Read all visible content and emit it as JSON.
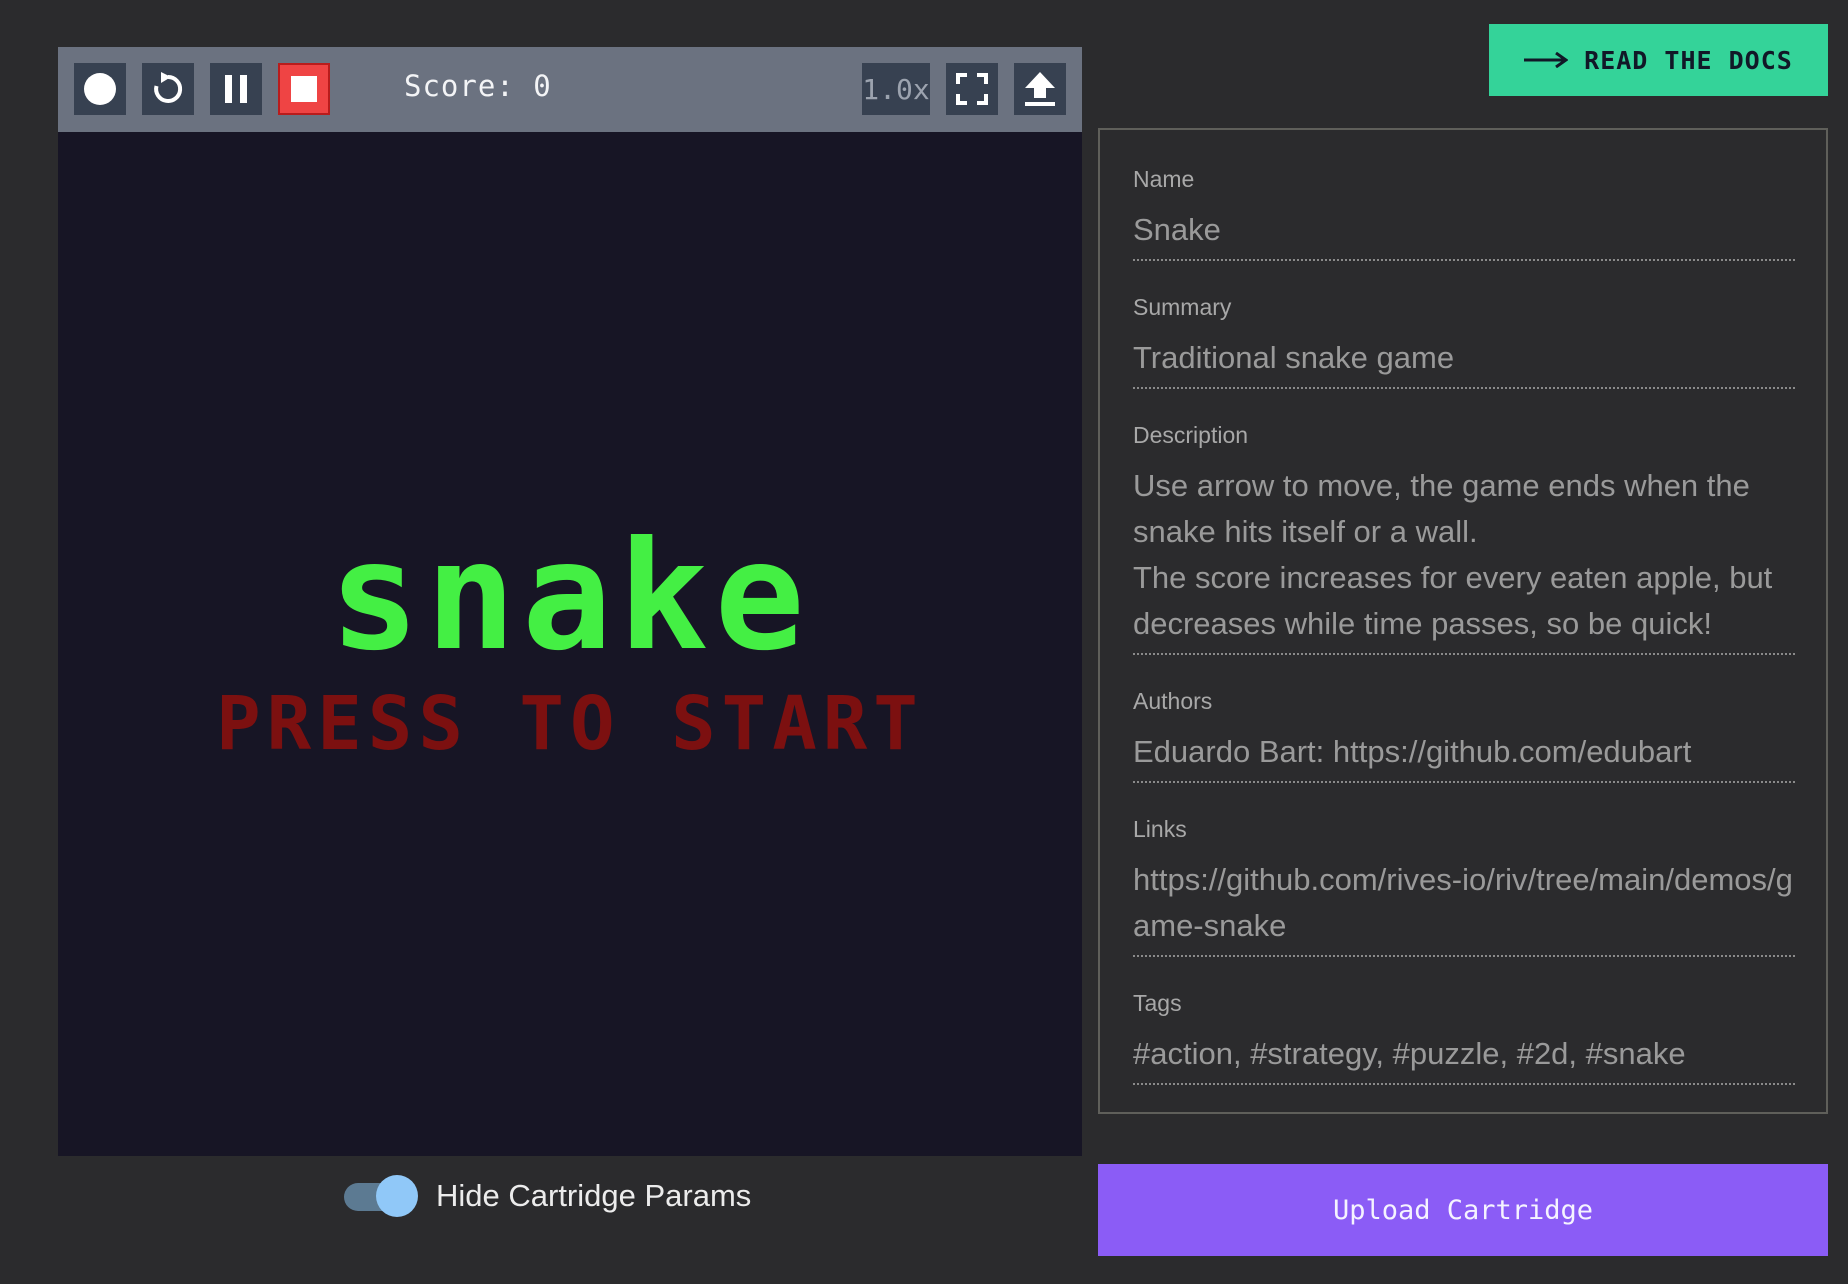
{
  "toolbar": {
    "score_text": "Score: 0",
    "speed": "1.0x",
    "icons": [
      "record-icon",
      "restart-icon",
      "pause-icon",
      "stop-icon",
      "fullscreen-icon",
      "upload-icon"
    ]
  },
  "game": {
    "title": "snake",
    "prompt": "PRESS TO START",
    "title_color": "#44ef44",
    "prompt_color": "#7c1010"
  },
  "toggle": {
    "label": "Hide Cartridge Params",
    "checked": true
  },
  "docs_button": {
    "label": "READ THE DOCS",
    "color": "#34d399"
  },
  "params": {
    "name": {
      "label": "Name",
      "value": "Snake"
    },
    "summary": {
      "label": "Summary",
      "value": "Traditional snake game"
    },
    "description": {
      "label": "Description",
      "value": "Use arrow to move, the game ends when the snake hits itself or a wall.\nThe score increases for every eaten apple, but decreases while time passes, so be quick!"
    },
    "authors": {
      "label": "Authors",
      "value": "Eduardo Bart: https://github.com/edubart"
    },
    "links": {
      "label": "Links",
      "value": "https://github.com/rives-io/riv/tree/main/demos/game-snake"
    },
    "tags": {
      "label": "Tags",
      "value": "#action, #strategy, #puzzle, #2d, #snake"
    }
  },
  "upload_button": {
    "label": "Upload Cartridge",
    "color": "#8b5cf6"
  }
}
